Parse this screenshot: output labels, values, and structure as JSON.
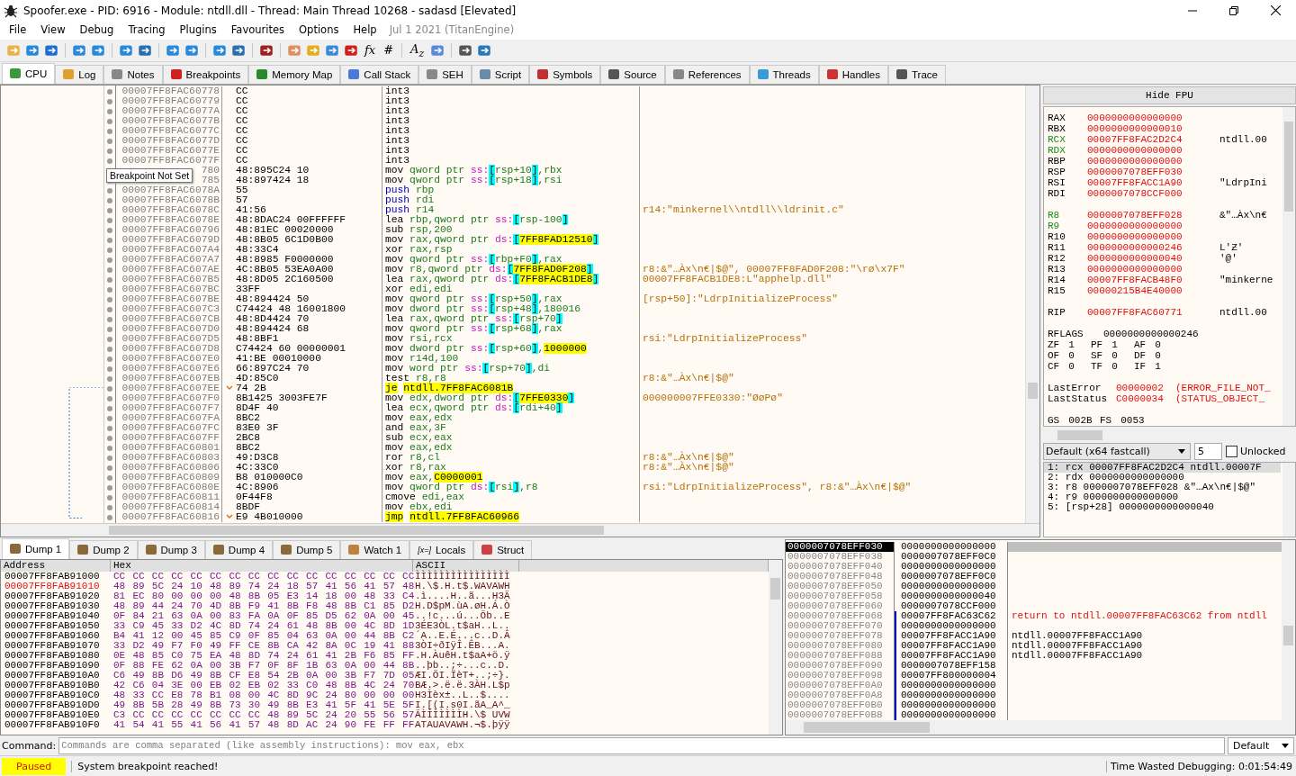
{
  "window": {
    "title": "Spoofer.exe - PID: 6916 - Module: ntdll.dll - Thread: Main Thread 10268 - sadasd [Elevated]"
  },
  "menu": [
    "File",
    "View",
    "Debug",
    "Tracing",
    "Plugins",
    "Favourites",
    "Options",
    "Help"
  ],
  "build_info": "Jul 1 2021 (TitanEngine)",
  "toolbar": [
    {
      "kind": "icon"
    },
    {
      "kind": "icon"
    },
    {
      "kind": "icon"
    },
    {
      "kind": "sep"
    },
    {
      "kind": "icon"
    },
    {
      "kind": "icon"
    },
    {
      "kind": "sep"
    },
    {
      "kind": "icon"
    },
    {
      "kind": "icon"
    },
    {
      "kind": "sep"
    },
    {
      "kind": "icon"
    },
    {
      "kind": "icon"
    },
    {
      "kind": "sep"
    },
    {
      "kind": "icon"
    },
    {
      "kind": "icon"
    },
    {
      "kind": "sep"
    },
    {
      "kind": "icon"
    },
    {
      "kind": "sep"
    },
    {
      "kind": "icon"
    },
    {
      "kind": "icon"
    },
    {
      "kind": "icon"
    },
    {
      "kind": "icon"
    },
    {
      "kind": "glyph",
      "text": "fx"
    },
    {
      "kind": "glyph",
      "text": "#"
    },
    {
      "kind": "sep"
    },
    {
      "kind": "glyph",
      "text": "A$_{z}$"
    },
    {
      "kind": "icon"
    },
    {
      "kind": "sep"
    },
    {
      "kind": "icon"
    },
    {
      "kind": "icon"
    }
  ],
  "tabs": [
    {
      "label": "CPU",
      "selected": true
    },
    {
      "label": "Log",
      "selected": false
    },
    {
      "label": "Notes",
      "selected": false
    },
    {
      "label": "Breakpoints",
      "selected": false
    },
    {
      "label": "Memory Map",
      "selected": false
    },
    {
      "label": "Call Stack",
      "selected": false
    },
    {
      "label": "SEH",
      "selected": false
    },
    {
      "label": "Script",
      "selected": false
    },
    {
      "label": "Symbols",
      "selected": false
    },
    {
      "label": "Source",
      "selected": false
    },
    {
      "label": "References",
      "selected": false
    },
    {
      "label": "Threads",
      "selected": false
    },
    {
      "label": "Handles",
      "selected": false
    },
    {
      "label": "Trace",
      "selected": false
    }
  ],
  "tooltip": "Breakpoint Not Set",
  "disassembly": [
    {
      "address": "00007FF8FAC60778",
      "bytes": "CC",
      "instruction": "int3",
      "kind": "plain"
    },
    {
      "address": "00007FF8FAC60779",
      "bytes": "CC",
      "instruction": "int3",
      "kind": "plain"
    },
    {
      "address": "00007FF8FAC6077A",
      "bytes": "CC",
      "instruction": "int3",
      "kind": "plain"
    },
    {
      "address": "00007FF8FAC6077B",
      "bytes": "CC",
      "instruction": "int3",
      "kind": "plain"
    },
    {
      "address": "00007FF8FAC6077C",
      "bytes": "CC",
      "instruction": "int3",
      "kind": "plain"
    },
    {
      "address": "00007FF8FAC6077D",
      "bytes": "CC",
      "instruction": "int3",
      "kind": "plain"
    },
    {
      "address": "00007FF8FAC6077E",
      "bytes": "CC",
      "instruction": "int3",
      "kind": "plain"
    },
    {
      "address": "00007FF8FAC6077F",
      "bytes": "CC",
      "instruction": "int3",
      "kind": "plain"
    },
    {
      "address": "780",
      "bytes": "48:895C24 10",
      "instruction": "mov qword ptr ss:[rsp+10],rbx",
      "kind": "plain"
    },
    {
      "address": "785",
      "bytes": "48:897424 18",
      "instruction": "mov qword ptr ss:[rsp+18],rsi",
      "kind": "plain"
    },
    {
      "address": "00007FF8FAC6078A",
      "bytes": "55",
      "instruction": "push rbp",
      "kind": "stack"
    },
    {
      "address": "00007FF8FAC6078B",
      "bytes": "57",
      "instruction": "push rdi",
      "kind": "stack"
    },
    {
      "address": "00007FF8FAC6078C",
      "bytes": "41:56",
      "instruction": "push r14",
      "kind": "stack",
      "comment": "r14:\"minkernel\\\\ntdll\\\\ldrinit.c\""
    },
    {
      "address": "00007FF8FAC6078E",
      "bytes": "48:8DAC24 00FFFFFF",
      "instruction": "lea rbp,qword ptr ss:[rsp-100]",
      "kind": "plain"
    },
    {
      "address": "00007FF8FAC60796",
      "bytes": "48:81EC 00020000",
      "instruction": "sub rsp,200",
      "kind": "plain"
    },
    {
      "address": "00007FF8FAC6079D",
      "bytes": "48:8B05 6C1D0B00",
      "instruction": "mov rax,qword ptr ds:[7FF8FAD12510]",
      "kind": "plain"
    },
    {
      "address": "00007FF8FAC607A4",
      "bytes": "48:33C4",
      "instruction": "xor rax,rsp",
      "kind": "plain"
    },
    {
      "address": "00007FF8FAC607A7",
      "bytes": "48:8985 F0000000",
      "instruction": "mov qword ptr ss:[rbp+F0],rax",
      "kind": "plain"
    },
    {
      "address": "00007FF8FAC607AE",
      "bytes": "4C:8B05 53EA0A00",
      "instruction": "mov r8,qword ptr ds:[7FF8FAD0F208]",
      "kind": "plain",
      "comment": "r8:&\"…Àx\\n€|$@\", 00007FF8FAD0F208:\"\\rø\\x7F\""
    },
    {
      "address": "00007FF8FAC607B5",
      "bytes": "48:8D05 2C160500",
      "instruction": "lea rax,qword ptr ds:[7FF8FACB1DE8]",
      "kind": "plain",
      "comment": "00007FF8FACB1DE8:L\"apphelp.dll\""
    },
    {
      "address": "00007FF8FAC607BC",
      "bytes": "33FF",
      "instruction": "xor edi,edi",
      "kind": "plain"
    },
    {
      "address": "00007FF8FAC607BE",
      "bytes": "48:894424 50",
      "instruction": "mov qword ptr ss:[rsp+50],rax",
      "kind": "plain",
      "comment": "[rsp+50]:\"LdrpInitializeProcess\""
    },
    {
      "address": "00007FF8FAC607C3",
      "bytes": "C74424 48 16001800",
      "instruction": "mov dword ptr ss:[rsp+48],180016",
      "kind": "plain"
    },
    {
      "address": "00007FF8FAC607CB",
      "bytes": "48:8D4424 70",
      "instruction": "lea rax,qword ptr ss:[rsp+70]",
      "kind": "plain"
    },
    {
      "address": "00007FF8FAC607D0",
      "bytes": "48:894424 68",
      "instruction": "mov qword ptr ss:[rsp+68],rax",
      "kind": "plain"
    },
    {
      "address": "00007FF8FAC607D5",
      "bytes": "48:8BF1",
      "instruction": "mov rsi,rcx",
      "kind": "plain",
      "comment": "rsi:\"LdrpInitializeProcess\""
    },
    {
      "address": "00007FF8FAC607D8",
      "bytes": "C74424 60 00000001",
      "instruction": "mov dword ptr ss:[rsp+60],1000000",
      "kind": "plain"
    },
    {
      "address": "00007FF8FAC607E0",
      "bytes": "41:BE 00010000",
      "instruction": "mov r14d,100",
      "kind": "plain"
    },
    {
      "address": "00007FF8FAC607E6",
      "bytes": "66:897C24 70",
      "instruction": "mov word ptr ss:[rsp+70],di",
      "kind": "plain"
    },
    {
      "address": "00007FF8FAC607EB",
      "bytes": "4D:85C0",
      "instruction": "test r8,r8",
      "kind": "plain",
      "comment": "r8:&\"…Àx\\n€|$@\""
    },
    {
      "address": "00007FF8FAC607EE",
      "bytes": "74 2B",
      "instruction": "je ntdll.7FF8FAC6081B",
      "kind": "jump"
    },
    {
      "address": "00007FF8FAC607F0",
      "bytes": "8B1425 3003FE7F",
      "instruction": "mov edx,dword ptr ds:[7FFE0330]",
      "kind": "plain",
      "comment": "000000007FFE0330:\"ØøPø\""
    },
    {
      "address": "00007FF8FAC607F7",
      "bytes": "8D4F 40",
      "instruction": "lea ecx,qword ptr ds:[rdi+40]",
      "kind": "plain"
    },
    {
      "address": "00007FF8FAC607FA",
      "bytes": "8BC2",
      "instruction": "mov eax,edx",
      "kind": "plain"
    },
    {
      "address": "00007FF8FAC607FC",
      "bytes": "83E0 3F",
      "instruction": "and eax,3F",
      "kind": "plain"
    },
    {
      "address": "00007FF8FAC607FF",
      "bytes": "2BC8",
      "instruction": "sub ecx,eax",
      "kind": "plain"
    },
    {
      "address": "00007FF8FAC60801",
      "bytes": "8BC2",
      "instruction": "mov eax,edx",
      "kind": "plain"
    },
    {
      "address": "00007FF8FAC60803",
      "bytes": "49:D3C8",
      "instruction": "ror r8,cl",
      "kind": "plain",
      "comment": "r8:&\"…Àx\\n€|$@\""
    },
    {
      "address": "00007FF8FAC60806",
      "bytes": "4C:33C0",
      "instruction": "xor r8,rax",
      "kind": "plain",
      "comment": "r8:&\"…Àx\\n€|$@\""
    },
    {
      "address": "00007FF8FAC60809",
      "bytes": "B8 010000C0",
      "instruction": "mov eax,C0000001",
      "kind": "plain"
    },
    {
      "address": "00007FF8FAC6080E",
      "bytes": "4C:8906",
      "instruction": "mov qword ptr ds:[rsi],r8",
      "kind": "plain",
      "comment": "rsi:\"LdrpInitializeProcess\", r8:&\"…Àx\\n€|$@\""
    },
    {
      "address": "00007FF8FAC60811",
      "bytes": "0F44F8",
      "instruction": "cmove edi,eax",
      "kind": "plain"
    },
    {
      "address": "00007FF8FAC60814",
      "bytes": "8BDF",
      "instruction": "mov ebx,edi",
      "kind": "plain"
    },
    {
      "address": "00007FF8FAC60816",
      "bytes": "E9 4B010000",
      "instruction": "jmp ntdll.7FF8FAC60966",
      "kind": "jump"
    }
  ],
  "fpu_button": "Hide FPU",
  "registers": [
    [
      {
        "name": "RAX",
        "value": "0000000000000000",
        "changed": false
      },
      {
        "name": "RBX",
        "value": "0000000000000010",
        "changed": false
      },
      {
        "name": "RCX",
        "value": "00007FF8FAC2D2C4",
        "comment": "ntdll.00",
        "changed": true
      },
      {
        "name": "RDX",
        "value": "0000000000000000",
        "changed": true
      },
      {
        "name": "RBP",
        "value": "0000000000000000",
        "changed": false
      },
      {
        "name": "RSP",
        "value": "0000007078EFF030",
        "changed": false
      },
      {
        "name": "RSI",
        "value": "00007FF8FACC1A90",
        "comment": "\"LdrpIni",
        "changed": false
      },
      {
        "name": "RDI",
        "value": "0000007078CCF000",
        "changed": false
      }
    ],
    [
      {
        "name": "R8",
        "value": "0000007078EFF028",
        "comment": "&\"…Àx\\n€",
        "changed": true
      },
      {
        "name": "R9",
        "value": "0000000000000000",
        "changed": true
      },
      {
        "name": "R10",
        "value": "0000000000000000",
        "changed": false
      },
      {
        "name": "R11",
        "value": "0000000000000246",
        "comment": "L'Ƶ'",
        "changed": false
      },
      {
        "name": "R12",
        "value": "0000000000000040",
        "comment": "'@'",
        "changed": false
      },
      {
        "name": "R13",
        "value": "0000000000000000",
        "changed": false
      },
      {
        "name": "R14",
        "value": "00007FF8FACB48F0",
        "comment": "\"minkerne",
        "changed": false
      },
      {
        "name": "R15",
        "value": "00000215B4E40000",
        "changed": false
      }
    ],
    [
      {
        "name": "RIP",
        "value": "00007FF8FAC60771",
        "comment": "ntdll.00",
        "changed": false
      }
    ]
  ],
  "rflags": {
    "name": "RFLAGS",
    "value": "0000000000000246"
  },
  "flags": [
    [
      {
        "name": "ZF",
        "value": "1"
      },
      {
        "name": "PF",
        "value": "1"
      },
      {
        "name": "AF",
        "value": "0"
      }
    ],
    [
      {
        "name": "OF",
        "value": "0"
      },
      {
        "name": "SF",
        "value": "0"
      },
      {
        "name": "DF",
        "value": "0"
      }
    ],
    [
      {
        "name": "CF",
        "value": "0"
      },
      {
        "name": "TF",
        "value": "0"
      },
      {
        "name": "IF",
        "value": "1"
      }
    ]
  ],
  "last": [
    {
      "name": "LastError",
      "code": "00000002",
      "text": "(ERROR_FILE_NOT_"
    },
    {
      "name": "LastStatus",
      "code": "C0000034",
      "text": "(STATUS_OBJECT_"
    }
  ],
  "segments": [
    {
      "name": "GS",
      "value": "002B"
    },
    {
      "name": "FS",
      "value": "0053"
    }
  ],
  "call_args": {
    "convention": "Default (x64 fastcall)",
    "count": "5",
    "unlocked": {
      "label": "Unlocked",
      "checked": false
    },
    "args": [
      {
        "text": "1: rcx 00007FF8FAC2D2C4 ntdll.00007F",
        "selected": true
      },
      {
        "text": "2: rdx 0000000000000000",
        "selected": false
      },
      {
        "text": "3: r8 0000007078EFF028 &\"…Àx\\n€|$@\"",
        "selected": false
      },
      {
        "text": "4: r9 0000000000000000",
        "selected": false
      },
      {
        "text": "5: [rsp+28] 0000000000000040",
        "selected": false
      }
    ]
  },
  "dump_tabs": [
    {
      "label": "Dump 1",
      "selected": true
    },
    {
      "label": "Dump 2",
      "selected": false
    },
    {
      "label": "Dump 3",
      "selected": false
    },
    {
      "label": "Dump 4",
      "selected": false
    },
    {
      "label": "Dump 5",
      "selected": false
    },
    {
      "label": "Watch 1",
      "selected": false
    },
    {
      "label": "Locals",
      "icon_text": "[x=]",
      "selected": false
    },
    {
      "label": "Struct",
      "selected": false
    }
  ],
  "dump": {
    "columns": [
      "Address",
      "Hex",
      "ASCII"
    ],
    "rows": [
      {
        "address": "00007FF8FAB91000",
        "hex": "CC CC CC CC CC CC CC CC CC CC CC CC CC CC CC CC",
        "ascii": "ÌÌÌÌÌÌÌÌÌÌÌÌÌÌÌÌ",
        "highlighted": false
      },
      {
        "address": "00007FF8FAB91010",
        "hex": "48 89 5C 24 10 48 89 74 24 18 57 41 56 41 57 48",
        "ascii": "H.\\$.H.t$.WAVAWH",
        "highlighted": true
      },
      {
        "address": "00007FF8FAB91020",
        "hex": "81 EC 80 00 00 00 48 8B 05 E3 14 18 00 48 33 C4",
        "ascii": ".ì....H..ã...H3Ä",
        "highlighted": false
      },
      {
        "address": "00007FF8FAB91030",
        "hex": "48 89 44 24 70 4D 8B F9 41 8B F8 48 8B C1 85 D2",
        "ascii": "H.D$pM.ùA.øH.Á.Ò",
        "highlighted": false
      },
      {
        "address": "00007FF8FAB91040",
        "hex": "0F 84 21 63 0A 00 83 FA 0A 0F 85 D5 62 0A 00 45",
        "ascii": "..!c...ú...Õb..E",
        "highlighted": false
      },
      {
        "address": "00007FF8FAB91050",
        "hex": "33 C9 45 33 D2 4C 8D 74 24 61 48 8B 00 4C 8D 1D",
        "ascii": "3ÉE3ÒL.t$aH..L..",
        "highlighted": false
      },
      {
        "address": "00007FF8FAB91060",
        "hex": "B4 41 12 00 45 85 C9 0F 85 04 63 0A 00 44 8B C2",
        "ascii": "´A..E.É...c..D.Â",
        "highlighted": false
      },
      {
        "address": "00007FF8FAB91070",
        "hex": "33 D2 49 F7 F0 49 FF CE 8B CA 42 8A 0C 19 41 88",
        "ascii": "3ÒI÷ðIÿÎ.ÊB...A.",
        "highlighted": false
      },
      {
        "address": "00007FF8FAB91080",
        "hex": "0E 48 85 C0 75 EA 48 8D 74 24 61 41 2B F6 85 FF",
        "ascii": ".H.ÀuêH.t$aA+ö.ÿ",
        "highlighted": false
      },
      {
        "address": "00007FF8FAB91090",
        "hex": "0F 88 FE 62 0A 00 3B F7 0F 8F 1B 63 0A 00 44 8B",
        "ascii": "..þb..;÷...c..D.",
        "highlighted": false
      },
      {
        "address": "00007FF8FAB910A0",
        "hex": "C6 49 8B D6 49 8B CF E8 54 2B 0A 00 3B F7 7D 05",
        "ascii": "ÆI.ÖI.ÏèT+..;÷}.",
        "highlighted": false
      },
      {
        "address": "00007FF8FAB910B0",
        "hex": "42 C6 04 3E 00 EB 02 EB 02 33 C0 48 8B 4C 24 70",
        "ascii": "BÆ.>.ë.ë.3ÀH.L$p",
        "highlighted": false
      },
      {
        "address": "00007FF8FAB910C0",
        "hex": "48 33 CC E8 78 B1 08 00 4C 8D 9C 24 80 00 00 00",
        "ascii": "H3Ìèx±..L..$....",
        "highlighted": false
      },
      {
        "address": "00007FF8FAB910D0",
        "hex": "49 8B 5B 28 49 8B 73 30 49 8B E3 41 5F 41 5E 5F",
        "ascii": "I.[(I.s0I.ãA_A^_",
        "highlighted": false
      },
      {
        "address": "00007FF8FAB910E0",
        "hex": "C3 CC CC CC CC CC CC CC 48 89 5C 24 20 55 56 57",
        "ascii": "ÃÌÌÌÌÌÌÌH.\\$ UVW",
        "highlighted": false
      },
      {
        "address": "00007FF8FAB910F0",
        "hex": "41 54 41 55 41 56 41 57 48 8D AC 24 90 FE FF FF",
        "ascii": "ATAUAVAWH.¬$.þÿÿ",
        "highlighted": false
      }
    ]
  },
  "stack": [
    {
      "address": "0000007078EFF030",
      "value": "0000000000000000",
      "selected": true,
      "frame": false
    },
    {
      "address": "0000007078EFF038",
      "value": "0000007078EFF0C0",
      "selected": false,
      "frame": false
    },
    {
      "address": "0000007078EFF040",
      "value": "0000000000000000",
      "selected": false,
      "frame": false
    },
    {
      "address": "0000007078EFF048",
      "value": "0000007078EFF0C0",
      "selected": false,
      "frame": false
    },
    {
      "address": "0000007078EFF050",
      "value": "0000000000000000",
      "selected": false,
      "frame": false
    },
    {
      "address": "0000007078EFF058",
      "value": "0000000000000040",
      "selected": false,
      "frame": false
    },
    {
      "address": "0000007078EFF060",
      "value": "0000007078CCF000",
      "selected": false,
      "frame": false
    },
    {
      "address": "0000007078EFF068",
      "value": "00007FF8FAC63C62",
      "comment": "return to ntdll.00007FF8FAC63C62 from ntdll",
      "kind": "return",
      "selected": false,
      "frame": true
    },
    {
      "address": "0000007078EFF070",
      "value": "0000000000000000",
      "selected": false,
      "frame": true
    },
    {
      "address": "0000007078EFF078",
      "value": "00007FF8FACC1A90",
      "comment": "ntdll.00007FF8FACC1A90",
      "kind": "normal",
      "selected": false,
      "frame": true
    },
    {
      "address": "0000007078EFF080",
      "value": "00007FF8FACC1A90",
      "comment": "ntdll.00007FF8FACC1A90",
      "kind": "normal",
      "selected": false,
      "frame": true
    },
    {
      "address": "0000007078EFF088",
      "value": "00007FF8FACC1A90",
      "comment": "ntdll.00007FF8FACC1A90",
      "kind": "normal",
      "selected": false,
      "frame": true
    },
    {
      "address": "0000007078EFF090",
      "value": "0000007078EFF158",
      "selected": false,
      "frame": true
    },
    {
      "address": "0000007078EFF098",
      "value": "00007FF800000004",
      "selected": false,
      "frame": true
    },
    {
      "address": "0000007078EFF0A0",
      "value": "0000000000000000",
      "selected": false,
      "frame": true
    },
    {
      "address": "0000007078EFF0A8",
      "value": "0000000000000000",
      "selected": false,
      "frame": true
    },
    {
      "address": "0000007078EFF0B0",
      "value": "0000000000000000",
      "selected": false,
      "frame": true
    },
    {
      "address": "0000007078EFF0B8",
      "value": "0000000000000000",
      "selected": false,
      "frame": true
    }
  ],
  "command": {
    "label": "Command:",
    "placeholder": "Commands are comma separated (like assembly instructions): mov eax, ebx",
    "mode": "Default"
  },
  "status": {
    "state": "Paused",
    "message": "System breakpoint reached!",
    "time": "Time Wasted Debugging: 0:01:54:49"
  }
}
